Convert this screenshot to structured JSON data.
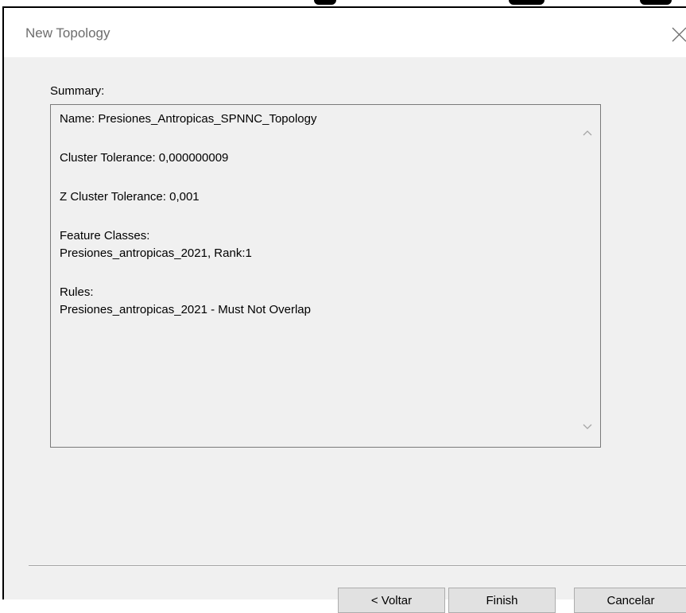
{
  "window": {
    "title": "New Topology"
  },
  "summary": {
    "label": "Summary:",
    "name_line": "Name: Presiones_Antropicas_SPNNC_Topology",
    "cluster_tolerance_line": "Cluster Tolerance: 0,000000009",
    "z_cluster_tolerance_line": "Z Cluster Tolerance: 0,001",
    "feature_classes_heading": "Feature Classes:",
    "feature_classes_value": "Presiones_antropicas_2021, Rank:1",
    "rules_heading": "Rules:",
    "rules_value": "Presiones_antropicas_2021 - Must Not Overlap"
  },
  "buttons": {
    "back": "< Voltar",
    "finish": "Finish",
    "cancel": "Cancelar"
  },
  "icons": {
    "close": "close-icon",
    "scroll_up": "chevron-up-icon",
    "scroll_down": "chevron-down-icon"
  }
}
